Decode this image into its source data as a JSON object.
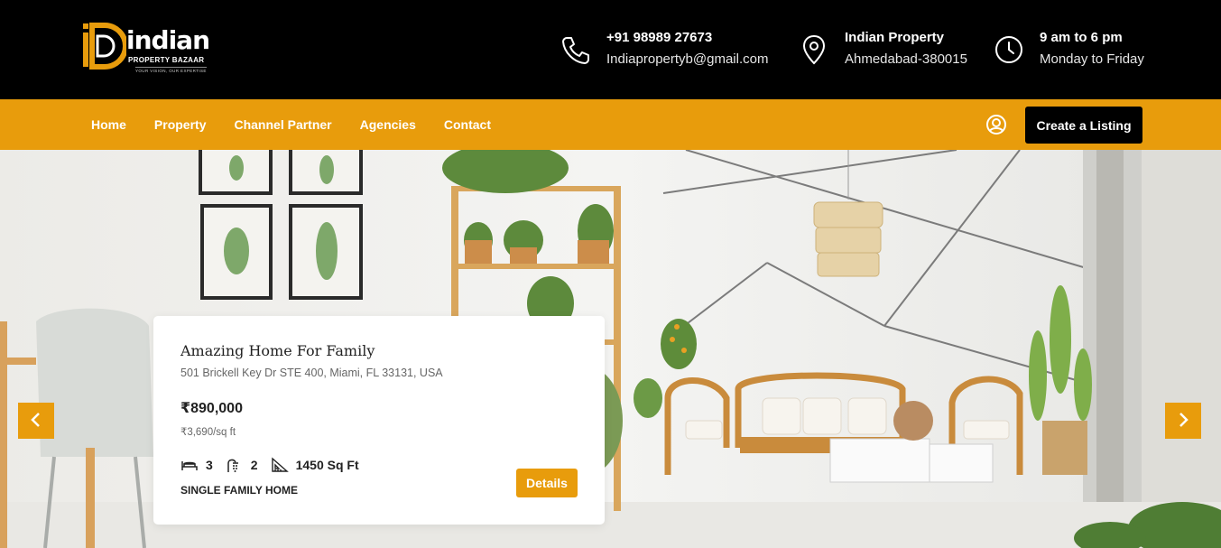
{
  "brand": {
    "name": "indian",
    "subtitle": "PROPERTY BAZAAR",
    "tagline": "YOUR VISION, OUR EXPERTISE",
    "accent": "#e89c0c"
  },
  "contacts": {
    "phone": {
      "icon": "phone-icon",
      "line1": "+91 98989 27673",
      "line2": "Indiapropertyb@gmail.com"
    },
    "location": {
      "icon": "location-pin-icon",
      "line1": "Indian Property",
      "line2": "Ahmedabad-380015"
    },
    "hours": {
      "icon": "clock-icon",
      "line1": "9 am to 6 pm",
      "line2": "Monday to Friday"
    }
  },
  "nav": {
    "items": [
      {
        "label": "Home"
      },
      {
        "label": "Property"
      },
      {
        "label": "Channel Partner"
      },
      {
        "label": "Agencies"
      },
      {
        "label": "Contact"
      }
    ],
    "user_icon": "user-circle-icon",
    "cta_label": "Create a Listing"
  },
  "listing": {
    "title": "Amazing Home For Family",
    "address": "501 Brickell Key Dr STE 400, Miami, FL 33131, USA",
    "price": "₹890,000",
    "price_per_sqft": "₹3,690/sq ft",
    "beds": "3",
    "baths": "2",
    "area": "1450 Sq Ft",
    "type": "SINGLE FAMILY HOME",
    "details_label": "Details"
  },
  "slider": {
    "prev_icon": "chevron-left-icon",
    "next_icon": "chevron-right-icon"
  }
}
